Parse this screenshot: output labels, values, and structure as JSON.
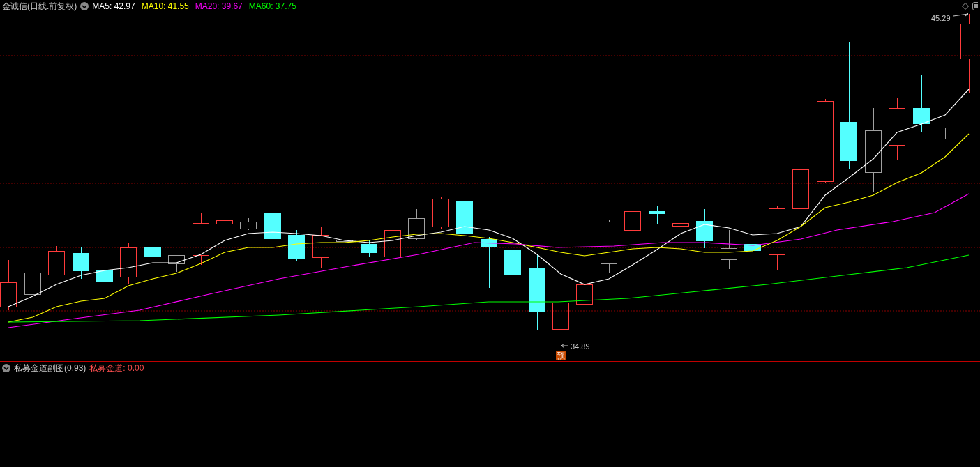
{
  "main_panel": {
    "title": "金诚信(日线.前复权)",
    "indicators": [
      {
        "text": "MA5: 42.97",
        "color": "#ffffff"
      },
      {
        "text": "MA10: 41.55",
        "color": "#ffff00"
      },
      {
        "text": "MA20: 39.67",
        "color": "#ff00ff"
      },
      {
        "text": "MA60: 37.75",
        "color": "#00ff00"
      }
    ],
    "high_label": "45.29",
    "low_label": "34.89",
    "badge": "预"
  },
  "sub_panel": {
    "title": "私募金道副图(0.93)",
    "indicator": {
      "text": "私募金道: 0.00",
      "color": "#ff5050"
    }
  }
}
